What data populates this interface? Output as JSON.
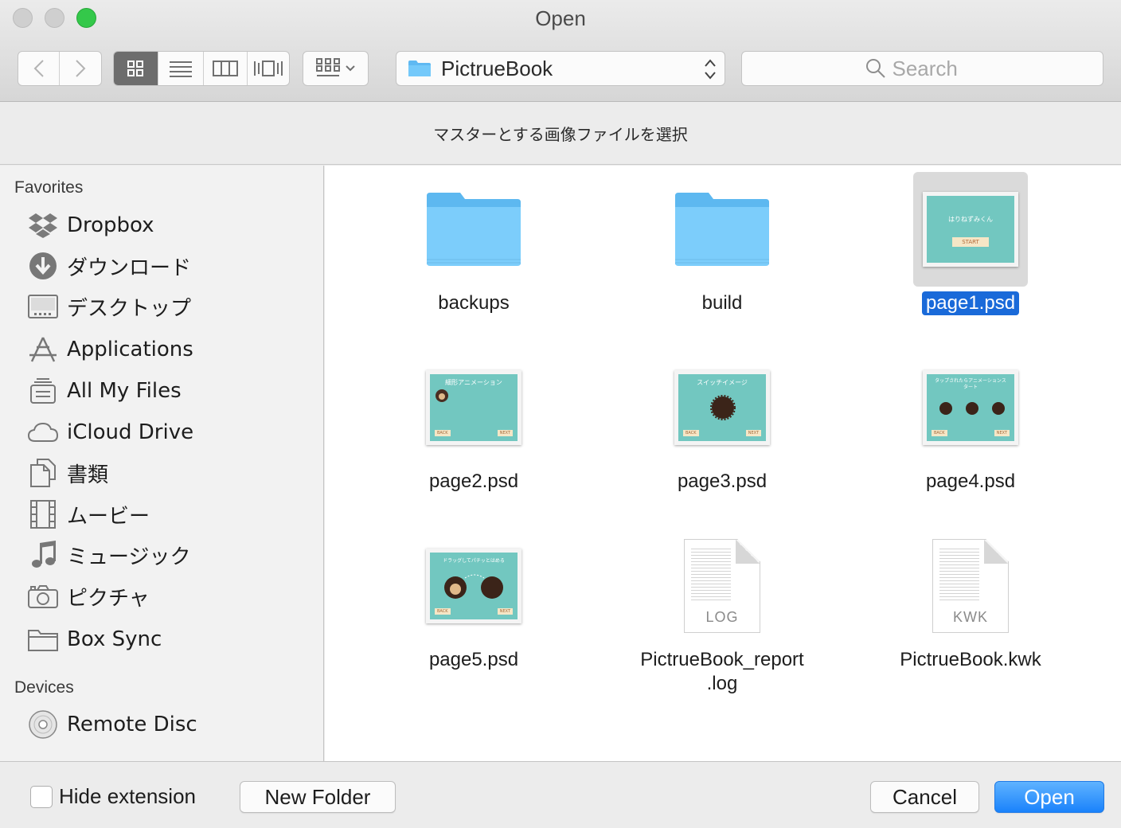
{
  "window": {
    "title": "Open"
  },
  "toolbar": {
    "back_icon": "chevron-left-icon",
    "forward_icon": "chevron-right-icon",
    "views": [
      "icon-view-icon",
      "list-view-icon",
      "column-view-icon",
      "coverflow-view-icon"
    ],
    "arrange_icon": "arrange-grid-icon",
    "location": "PictrueBook",
    "search_placeholder": "Search"
  },
  "message": "マスターとする画像ファイルを選択",
  "sidebar": {
    "favorites_heading": "Favorites",
    "favorites": [
      {
        "label": "Dropbox",
        "icon": "dropbox-icon"
      },
      {
        "label": "ダウンロード",
        "icon": "download-icon"
      },
      {
        "label": "デスクトップ",
        "icon": "desktop-icon"
      },
      {
        "label": "Applications",
        "icon": "applications-icon"
      },
      {
        "label": "All My Files",
        "icon": "all-files-icon"
      },
      {
        "label": "iCloud Drive",
        "icon": "cloud-icon"
      },
      {
        "label": "書類",
        "icon": "documents-icon"
      },
      {
        "label": "ムービー",
        "icon": "movie-icon"
      },
      {
        "label": "ミュージック",
        "icon": "music-icon"
      },
      {
        "label": "ピクチャ",
        "icon": "camera-icon"
      },
      {
        "label": "Box Sync",
        "icon": "folder-icon"
      }
    ],
    "devices_heading": "Devices",
    "devices": [
      {
        "label": "Remote Disc",
        "icon": "disc-icon"
      }
    ]
  },
  "files": [
    {
      "name": "backups",
      "kind": "folder"
    },
    {
      "name": "build",
      "kind": "folder"
    },
    {
      "name": "page1.psd",
      "kind": "psd",
      "selected": true,
      "thumb_title": "はりねずみくん",
      "thumb_button": "START"
    },
    {
      "name": "page2.psd",
      "kind": "psd",
      "thumb_title": "細形アニメーション",
      "thumb_back": "BACK",
      "thumb_next": "NEXT"
    },
    {
      "name": "page3.psd",
      "kind": "psd",
      "thumb_title": "スイッチイメージ",
      "thumb_back": "BACK",
      "thumb_next": "NEXT"
    },
    {
      "name": "page4.psd",
      "kind": "psd",
      "thumb_title": "タップされたらアニメーションスタート",
      "thumb_back": "BACK",
      "thumb_next": "NEXT"
    },
    {
      "name": "page5.psd",
      "kind": "psd",
      "thumb_title": "ドラッグしてパチッとはめる",
      "thumb_back": "BACK",
      "thumb_next": "NEXT"
    },
    {
      "name": "PictrueBook_report",
      "name_line2": ".log",
      "kind": "doc",
      "ext": "LOG"
    },
    {
      "name": "PictrueBook.kwk",
      "kind": "doc",
      "ext": "KWK"
    }
  ],
  "footer": {
    "hide_extension_label": "Hide extension",
    "hide_extension_checked": false,
    "new_folder_label": "New Folder",
    "cancel_label": "Cancel",
    "open_label": "Open"
  },
  "colors": {
    "accent": "#1a82fb",
    "selection": "#1a6ad9",
    "folder": "#6ac5f7",
    "thumb_bg": "#72c7c0"
  }
}
